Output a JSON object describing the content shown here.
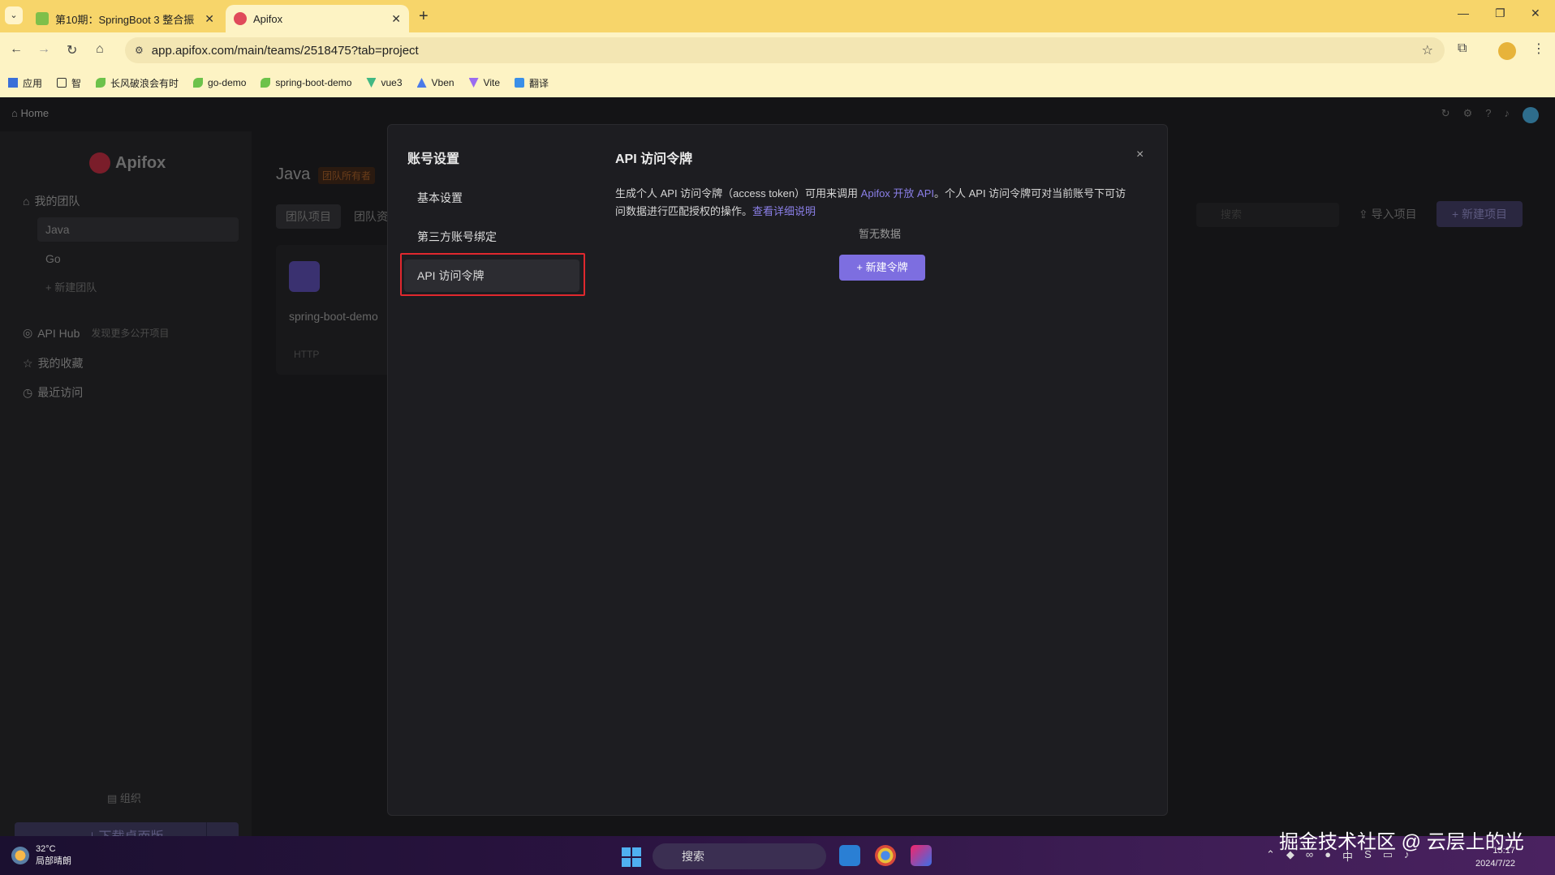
{
  "browser": {
    "tabs": [
      {
        "title": "第10期：SpringBoot 3 整合振",
        "active": false
      },
      {
        "title": "Apifox",
        "active": true
      }
    ],
    "url": "app.apifox.com/main/teams/2518475?tab=project",
    "bookmarks": [
      "应用",
      "智",
      "长风破浪会有时",
      "go-demo",
      "spring-boot-demo",
      "vue3",
      "Vben",
      "Vite",
      "翻译"
    ]
  },
  "app": {
    "home_label": "Home",
    "logo_text": "Apifox",
    "sidebar": {
      "my_teams_label": "我的团队",
      "teams": [
        "Java",
        "Go"
      ],
      "new_team_label": "+ 新建团队",
      "api_hub_label": "API Hub",
      "api_hub_sub": "发现更多公开项目",
      "favorites_label": "我的收藏",
      "recent_label": "最近访问",
      "org_label": "组织",
      "download_label": "下载桌面版"
    },
    "content": {
      "team_name": "Java",
      "team_badge": "团队所有者",
      "tabs": [
        "团队项目",
        "团队资源"
      ],
      "project_name": "spring-boot-demo",
      "project_type": "HTTP",
      "search_placeholder": "搜索",
      "import_label": "导入项目",
      "new_project_label": "+ 新建项目"
    }
  },
  "modal": {
    "side_title": "账号设置",
    "nav_items": [
      "基本设置",
      "第三方账号绑定",
      "API 访问令牌"
    ],
    "title": "API 访问令牌",
    "close_glyph": "×",
    "desc_part1": "生成个人 API 访问令牌（access token）可用来调用 ",
    "desc_link1": "Apifox 开放 API",
    "desc_part2": "。个人 API 访问令牌可对当前账号下可访问数据进行匹配授权的操作。",
    "desc_link2": "查看详细说明",
    "empty_text": "暂无数据",
    "new_token_label": "+ 新建令牌",
    "accent_color": "#7d6ee0"
  },
  "taskbar": {
    "temperature": "32°C",
    "weather_text": "局部晴朗",
    "search_label": "搜索",
    "ime": "中",
    "time": "15:17",
    "date": "2024/7/22"
  },
  "watermark": "掘金技术社区 @ 云层上的光"
}
